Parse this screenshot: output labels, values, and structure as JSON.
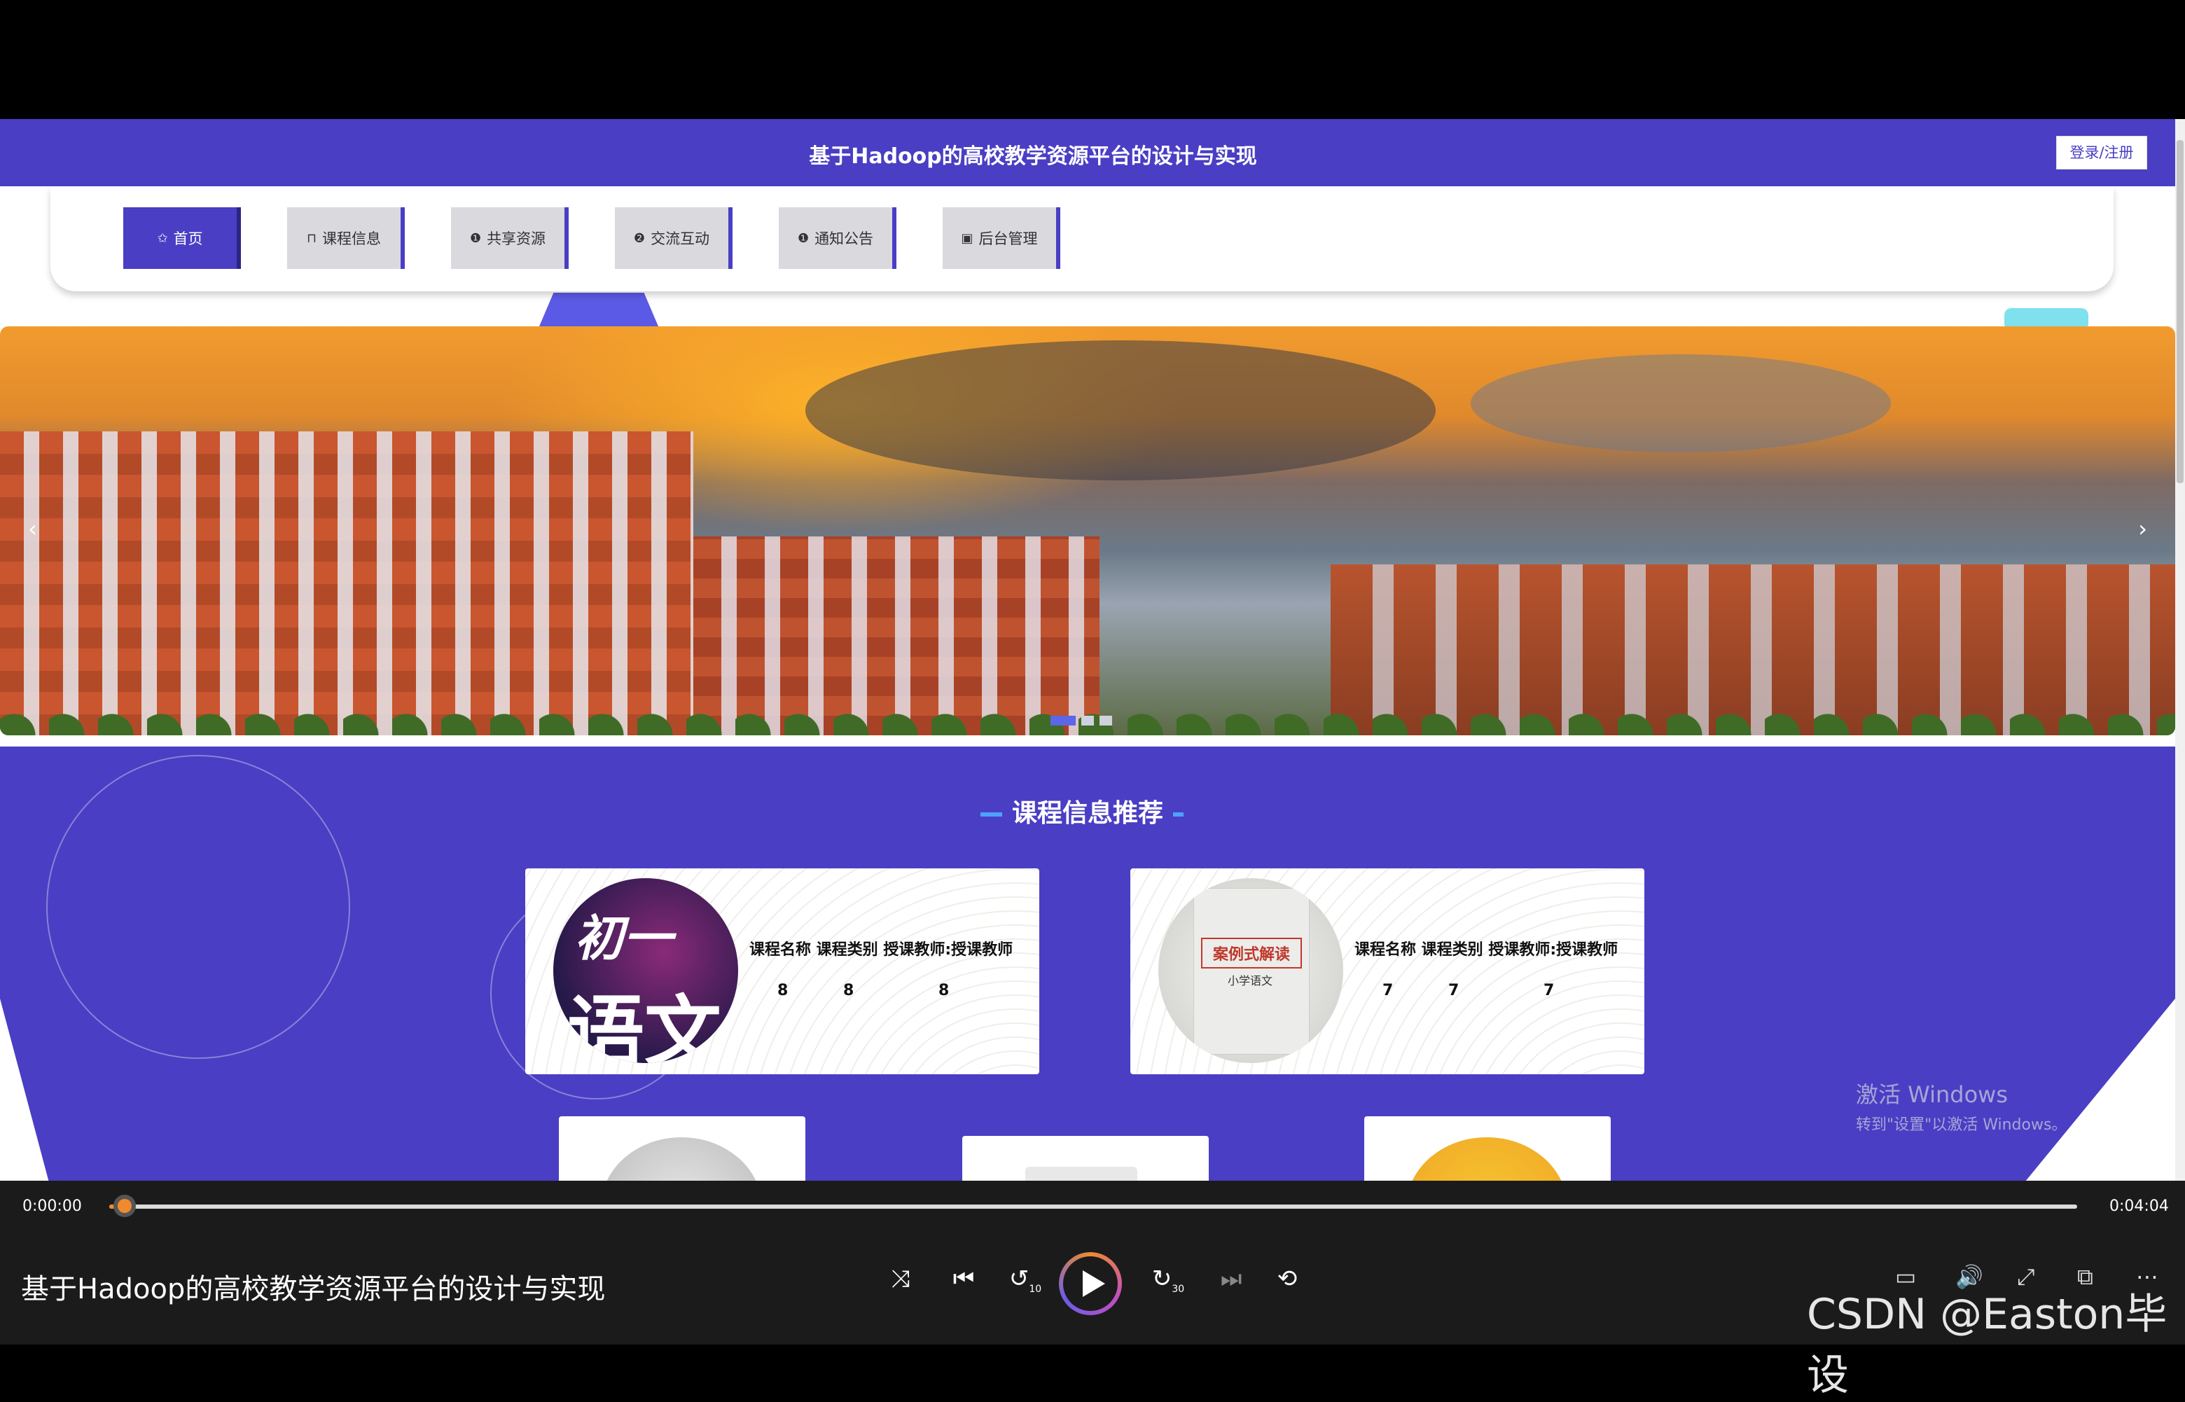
{
  "header": {
    "title": "基于Hadoop的高校教学资源平台的设计与实现",
    "login_label": "登录/注册"
  },
  "nav": [
    {
      "label": "首页",
      "icon": "star-icon",
      "glyph": "✩",
      "active": true
    },
    {
      "label": "课程信息",
      "icon": "bag-icon",
      "glyph": "⊓",
      "active": false
    },
    {
      "label": "共享资源",
      "icon": "alert-circle-icon",
      "glyph": "❶",
      "active": false
    },
    {
      "label": "交流互动",
      "icon": "question-circle-icon",
      "glyph": "❷",
      "active": false
    },
    {
      "label": "通知公告",
      "icon": "info-circle-icon",
      "glyph": "❶",
      "active": false
    },
    {
      "label": "后台管理",
      "icon": "calendar-icon",
      "glyph": "▣",
      "active": false
    }
  ],
  "banner": {
    "prev": "‹",
    "next": "›",
    "slide_count": 3,
    "active_slide": 1
  },
  "section": {
    "title": "课程信息推荐"
  },
  "courses": [
    {
      "thumb_line1": "初一",
      "thumb_line2": "语文",
      "headers": "课程名称 课程类别 授课教师:授课教师",
      "name": "8",
      "category": "8",
      "teacher": "8"
    },
    {
      "book_title": "案例式解读",
      "book_sub": "小学语文",
      "headers": "课程名称 课程类别 授课教师:授课教师",
      "name": "7",
      "category": "7",
      "teacher": "7"
    }
  ],
  "watermark": {
    "line1": "激活 Windows",
    "line2": "转到\"设置\"以激活 Windows。"
  },
  "player": {
    "current_time": "0:00:00",
    "total_time": "0:04:04",
    "progress": 0.004,
    "title": "基于Hadoop的高校教学资源平台的设计与实现",
    "controls": {
      "shuffle": "⤨",
      "prev": "⏮",
      "rewind": "↺",
      "rewind_label": "10",
      "forward": "↻",
      "forward_label": "30",
      "next": "⏭",
      "repeat": "⟲"
    },
    "right_icons": {
      "captions": "▭",
      "volume": "🔊",
      "expand": "⤢",
      "pip": "⧉",
      "more": "⋯"
    },
    "brand": "CSDN @Easton毕设"
  },
  "colors": {
    "accent": "#4a3ec4",
    "progress": "#f08a2e",
    "link_blue": "#4fa1ff"
  }
}
